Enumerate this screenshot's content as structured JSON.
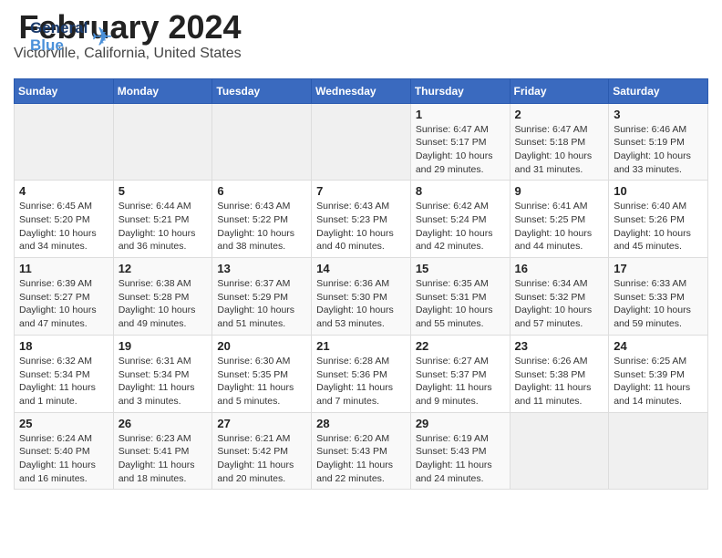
{
  "header": {
    "logo_line1": "General",
    "logo_line2": "Blue",
    "month_year": "February 2024",
    "location": "Victorville, California, United States"
  },
  "weekdays": [
    "Sunday",
    "Monday",
    "Tuesday",
    "Wednesday",
    "Thursday",
    "Friday",
    "Saturday"
  ],
  "weeks": [
    [
      {
        "day": "",
        "sunrise": "",
        "sunset": "",
        "daylight": "",
        "empty": true
      },
      {
        "day": "",
        "sunrise": "",
        "sunset": "",
        "daylight": "",
        "empty": true
      },
      {
        "day": "",
        "sunrise": "",
        "sunset": "",
        "daylight": "",
        "empty": true
      },
      {
        "day": "",
        "sunrise": "",
        "sunset": "",
        "daylight": "",
        "empty": true
      },
      {
        "day": "1",
        "sunrise": "Sunrise: 6:47 AM",
        "sunset": "Sunset: 5:17 PM",
        "daylight": "Daylight: 10 hours and 29 minutes.",
        "empty": false
      },
      {
        "day": "2",
        "sunrise": "Sunrise: 6:47 AM",
        "sunset": "Sunset: 5:18 PM",
        "daylight": "Daylight: 10 hours and 31 minutes.",
        "empty": false
      },
      {
        "day": "3",
        "sunrise": "Sunrise: 6:46 AM",
        "sunset": "Sunset: 5:19 PM",
        "daylight": "Daylight: 10 hours and 33 minutes.",
        "empty": false
      }
    ],
    [
      {
        "day": "4",
        "sunrise": "Sunrise: 6:45 AM",
        "sunset": "Sunset: 5:20 PM",
        "daylight": "Daylight: 10 hours and 34 minutes.",
        "empty": false
      },
      {
        "day": "5",
        "sunrise": "Sunrise: 6:44 AM",
        "sunset": "Sunset: 5:21 PM",
        "daylight": "Daylight: 10 hours and 36 minutes.",
        "empty": false
      },
      {
        "day": "6",
        "sunrise": "Sunrise: 6:43 AM",
        "sunset": "Sunset: 5:22 PM",
        "daylight": "Daylight: 10 hours and 38 minutes.",
        "empty": false
      },
      {
        "day": "7",
        "sunrise": "Sunrise: 6:43 AM",
        "sunset": "Sunset: 5:23 PM",
        "daylight": "Daylight: 10 hours and 40 minutes.",
        "empty": false
      },
      {
        "day": "8",
        "sunrise": "Sunrise: 6:42 AM",
        "sunset": "Sunset: 5:24 PM",
        "daylight": "Daylight: 10 hours and 42 minutes.",
        "empty": false
      },
      {
        "day": "9",
        "sunrise": "Sunrise: 6:41 AM",
        "sunset": "Sunset: 5:25 PM",
        "daylight": "Daylight: 10 hours and 44 minutes.",
        "empty": false
      },
      {
        "day": "10",
        "sunrise": "Sunrise: 6:40 AM",
        "sunset": "Sunset: 5:26 PM",
        "daylight": "Daylight: 10 hours and 45 minutes.",
        "empty": false
      }
    ],
    [
      {
        "day": "11",
        "sunrise": "Sunrise: 6:39 AM",
        "sunset": "Sunset: 5:27 PM",
        "daylight": "Daylight: 10 hours and 47 minutes.",
        "empty": false
      },
      {
        "day": "12",
        "sunrise": "Sunrise: 6:38 AM",
        "sunset": "Sunset: 5:28 PM",
        "daylight": "Daylight: 10 hours and 49 minutes.",
        "empty": false
      },
      {
        "day": "13",
        "sunrise": "Sunrise: 6:37 AM",
        "sunset": "Sunset: 5:29 PM",
        "daylight": "Daylight: 10 hours and 51 minutes.",
        "empty": false
      },
      {
        "day": "14",
        "sunrise": "Sunrise: 6:36 AM",
        "sunset": "Sunset: 5:30 PM",
        "daylight": "Daylight: 10 hours and 53 minutes.",
        "empty": false
      },
      {
        "day": "15",
        "sunrise": "Sunrise: 6:35 AM",
        "sunset": "Sunset: 5:31 PM",
        "daylight": "Daylight: 10 hours and 55 minutes.",
        "empty": false
      },
      {
        "day": "16",
        "sunrise": "Sunrise: 6:34 AM",
        "sunset": "Sunset: 5:32 PM",
        "daylight": "Daylight: 10 hours and 57 minutes.",
        "empty": false
      },
      {
        "day": "17",
        "sunrise": "Sunrise: 6:33 AM",
        "sunset": "Sunset: 5:33 PM",
        "daylight": "Daylight: 10 hours and 59 minutes.",
        "empty": false
      }
    ],
    [
      {
        "day": "18",
        "sunrise": "Sunrise: 6:32 AM",
        "sunset": "Sunset: 5:34 PM",
        "daylight": "Daylight: 11 hours and 1 minute.",
        "empty": false
      },
      {
        "day": "19",
        "sunrise": "Sunrise: 6:31 AM",
        "sunset": "Sunset: 5:34 PM",
        "daylight": "Daylight: 11 hours and 3 minutes.",
        "empty": false
      },
      {
        "day": "20",
        "sunrise": "Sunrise: 6:30 AM",
        "sunset": "Sunset: 5:35 PM",
        "daylight": "Daylight: 11 hours and 5 minutes.",
        "empty": false
      },
      {
        "day": "21",
        "sunrise": "Sunrise: 6:28 AM",
        "sunset": "Sunset: 5:36 PM",
        "daylight": "Daylight: 11 hours and 7 minutes.",
        "empty": false
      },
      {
        "day": "22",
        "sunrise": "Sunrise: 6:27 AM",
        "sunset": "Sunset: 5:37 PM",
        "daylight": "Daylight: 11 hours and 9 minutes.",
        "empty": false
      },
      {
        "day": "23",
        "sunrise": "Sunrise: 6:26 AM",
        "sunset": "Sunset: 5:38 PM",
        "daylight": "Daylight: 11 hours and 11 minutes.",
        "empty": false
      },
      {
        "day": "24",
        "sunrise": "Sunrise: 6:25 AM",
        "sunset": "Sunset: 5:39 PM",
        "daylight": "Daylight: 11 hours and 14 minutes.",
        "empty": false
      }
    ],
    [
      {
        "day": "25",
        "sunrise": "Sunrise: 6:24 AM",
        "sunset": "Sunset: 5:40 PM",
        "daylight": "Daylight: 11 hours and 16 minutes.",
        "empty": false
      },
      {
        "day": "26",
        "sunrise": "Sunrise: 6:23 AM",
        "sunset": "Sunset: 5:41 PM",
        "daylight": "Daylight: 11 hours and 18 minutes.",
        "empty": false
      },
      {
        "day": "27",
        "sunrise": "Sunrise: 6:21 AM",
        "sunset": "Sunset: 5:42 PM",
        "daylight": "Daylight: 11 hours and 20 minutes.",
        "empty": false
      },
      {
        "day": "28",
        "sunrise": "Sunrise: 6:20 AM",
        "sunset": "Sunset: 5:43 PM",
        "daylight": "Daylight: 11 hours and 22 minutes.",
        "empty": false
      },
      {
        "day": "29",
        "sunrise": "Sunrise: 6:19 AM",
        "sunset": "Sunset: 5:43 PM",
        "daylight": "Daylight: 11 hours and 24 minutes.",
        "empty": false
      },
      {
        "day": "",
        "sunrise": "",
        "sunset": "",
        "daylight": "",
        "empty": true
      },
      {
        "day": "",
        "sunrise": "",
        "sunset": "",
        "daylight": "",
        "empty": true
      }
    ]
  ]
}
